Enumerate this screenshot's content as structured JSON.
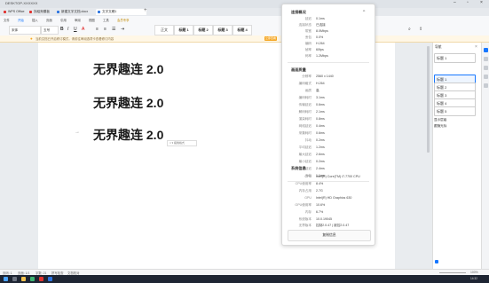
{
  "window": {
    "title": "DESKTOP-XXXXXX"
  },
  "tabs": [
    {
      "label": "WPS Office",
      "color": "#e0322f"
    },
    {
      "label": "找稻壳模板",
      "color": "#e0322f"
    },
    {
      "label": "新建文字文档.docx",
      "color": "#2b73e0"
    },
    {
      "label": "文字文稿1",
      "color": "#2b73e0"
    }
  ],
  "ribbon": {
    "menus": [
      "文件",
      "开始",
      "插入",
      "页面",
      "引用",
      "审阅",
      "视图",
      "工具",
      "会员专享"
    ],
    "font_name": "宋体",
    "font_size": "五号",
    "styles": [
      "正文",
      "标题 1",
      "标题 2",
      "标题 3",
      "标题 4"
    ]
  },
  "notice": {
    "text": "当前文档已开启修订模式，请前往审阅选项卡查看修订内容",
    "button": "立即查看"
  },
  "document": {
    "headings": [
      "无界趣连 2.0",
      "无界趣连 2.0",
      "无界趣连 2.0"
    ],
    "paragraph_mark": "→",
    "cursor_tip": "□ ▾ 拖拽格式"
  },
  "overlay": {
    "section1": {
      "title": "连接概况",
      "rows": [
        {
          "k": "延迟",
          "v": "0.1ms"
        },
        {
          "k": "连接状态",
          "v": "已连接"
        },
        {
          "k": "带宽",
          "v": "8.0Mbps"
        },
        {
          "k": "丢包",
          "v": "0.0%"
        },
        {
          "k": "编码",
          "v": "H.264"
        },
        {
          "k": "帧率",
          "v": "60fps"
        },
        {
          "k": "码率",
          "v": "1.2Mbps"
        }
      ]
    },
    "section2": {
      "title": "画面质量",
      "rows": [
        {
          "k": "分辨率",
          "v": "2560 x 1440"
        },
        {
          "k": "编码格式",
          "v": "H.264"
        },
        {
          "k": "画质",
          "v": "高"
        },
        {
          "k": "编码耗时",
          "v": "3.1ms"
        },
        {
          "k": "传输延迟",
          "v": "0.6ms"
        },
        {
          "k": "解码耗时",
          "v": "2.1ms"
        },
        {
          "k": "渲染耗时",
          "v": "0.8ms"
        },
        {
          "k": "网络延迟",
          "v": "0.4ms"
        },
        {
          "k": "采集耗时",
          "v": "0.6ms"
        },
        {
          "k": "抖动",
          "v": "0.2ms"
        },
        {
          "k": "平均延迟",
          "v": "1.2ms"
        },
        {
          "k": "最大延迟",
          "v": "2.6ms"
        },
        {
          "k": "最小延迟",
          "v": "0.2ms"
        },
        {
          "k": "总延迟",
          "v": "2.4ms"
        },
        {
          "k": "丢帧",
          "v": "1.1ms"
        }
      ]
    },
    "section3": {
      "title": "系统信息",
      "rows": [
        {
          "k": "CPU",
          "v": "Intel(R) Core(TM) i7-7700 CPU"
        },
        {
          "k": "CPU使用率",
          "v": "8.4%"
        },
        {
          "k": "内存占用",
          "v": "2.7G"
        },
        {
          "k": "GPU",
          "v": "Intel(R) HD Graphics 630"
        },
        {
          "k": "GPU使用率",
          "v": "10.6%"
        },
        {
          "k": "内存",
          "v": "6.7%"
        },
        {
          "k": "系统版本",
          "v": "10.0.19045"
        },
        {
          "k": "无界版本",
          "v": "控制2.0.47 | 被控2.0.47"
        }
      ]
    },
    "copy_button": "复制信息"
  },
  "navpane": {
    "header": "导航",
    "filter": "标题 1",
    "items": [
      "标题 1",
      "标题 2",
      "标题 3",
      "标题 4",
      "标题 5"
    ],
    "rows": [
      "显示层级",
      "跟随光标"
    ]
  },
  "statusbar": {
    "left": [
      "页码: 1",
      "页面: 1/1",
      "字数: 21",
      "拼写检查",
      "文档校对"
    ],
    "right": [
      "100%"
    ]
  },
  "taskbar": {
    "clock": "14:32"
  }
}
